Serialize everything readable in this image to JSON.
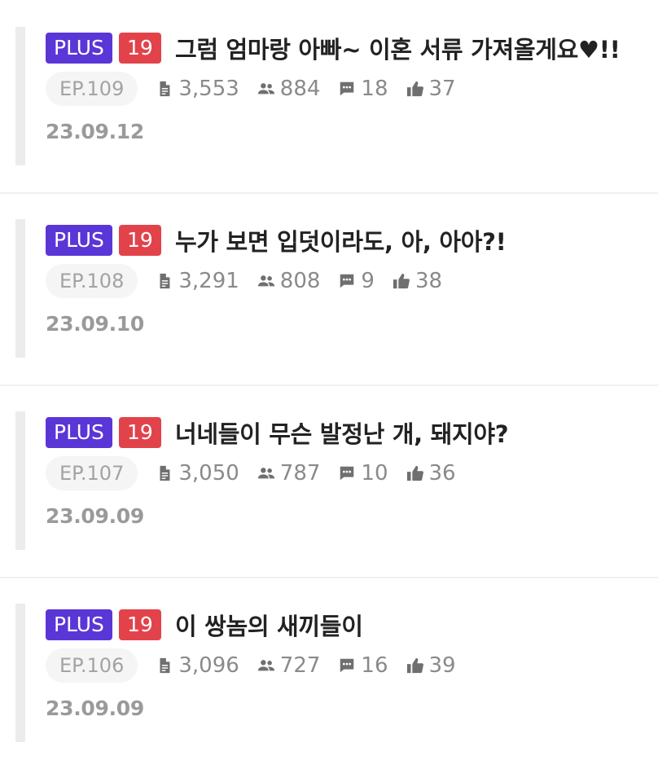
{
  "episodes": [
    {
      "plus_badge": "PLUS",
      "age_badge": "19",
      "title": "그럼 엄마랑 아빠~ 이혼 서류 가져올게요♥!!",
      "episode_number": "EP.109",
      "text_count": "3,553",
      "viewers": "884",
      "comments": "18",
      "likes": "37",
      "date": "23.09.12"
    },
    {
      "plus_badge": "PLUS",
      "age_badge": "19",
      "title": "누가 보면 입덧이라도, 아, 아아?!",
      "episode_number": "EP.108",
      "text_count": "3,291",
      "viewers": "808",
      "comments": "9",
      "likes": "38",
      "date": "23.09.10"
    },
    {
      "plus_badge": "PLUS",
      "age_badge": "19",
      "title": "너네들이 무슨 발정난 개, 돼지야?",
      "episode_number": "EP.107",
      "text_count": "3,050",
      "viewers": "787",
      "comments": "10",
      "likes": "36",
      "date": "23.09.09"
    },
    {
      "plus_badge": "PLUS",
      "age_badge": "19",
      "title": "이 쌍놈의 새끼들이",
      "episode_number": "EP.106",
      "text_count": "3,096",
      "viewers": "727",
      "comments": "16",
      "likes": "39",
      "date": "23.09.09"
    }
  ],
  "icons": {
    "text_count": "document-icon",
    "viewers": "people-icon",
    "comments": "comment-icon",
    "likes": "thumbs-up-icon"
  },
  "colors": {
    "plus_badge": "#5a36d6",
    "age_badge": "#e2434b"
  }
}
